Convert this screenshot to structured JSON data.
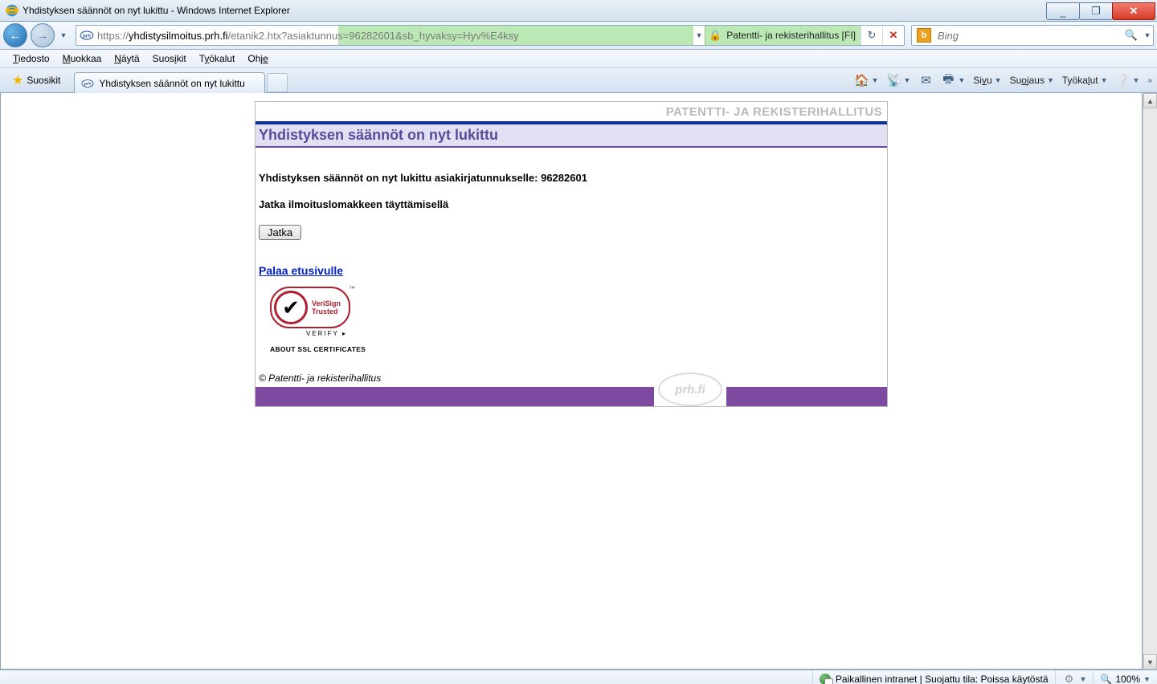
{
  "window": {
    "title": "Yhdistyksen säännöt on nyt lukittu - Windows Internet Explorer",
    "min_tip": "_",
    "max_tip": "❐",
    "close_tip": "✕"
  },
  "nav": {
    "url_scheme": "https://",
    "url_host": "yhdistysilmoitus.prh.fi",
    "url_path": "/etanik2.htx?asiaktunnus=96282601&sb_hyvaksy=Hyv%E4ksy",
    "sec_label": "Patentti- ja rekisterihallitus [FI]",
    "search_placeholder": "Bing"
  },
  "menu": {
    "file": "Tiedosto",
    "edit": "Muokkaa",
    "view": "Näytä",
    "favorites": "Suosikit",
    "tools": "Työkalut",
    "help": "Ohje"
  },
  "favbar": {
    "favorites_btn": "Suosikit",
    "tab_title": "Yhdistyksen säännöt on nyt lukittu"
  },
  "cmdbar": {
    "page": "Sivu",
    "safety": "Suojaus",
    "tools": "Työkalut"
  },
  "page": {
    "org": "PATENTTI- JA REKISTERIHALLITUS",
    "h1": "Yhdistyksen säännöt on nyt lukittu",
    "p1": "Yhdistyksen säännöt on nyt lukittu asiakirjatunnukselle: 96282601",
    "p2": "Jatka ilmoituslomakkeen täyttämisellä",
    "continue_btn": "Jatka",
    "home_link": "Palaa etusivulle",
    "vs_line1": "VeriSign",
    "vs_line2": "Trusted",
    "vs_verify": "VERIFY ▸",
    "vs_about": "ABOUT SSL CERTIFICATES",
    "copyright": "© Patentti- ja rekisterihallitus",
    "prh_logo": "prh.fi"
  },
  "status": {
    "zone": "Paikallinen intranet | Suojattu tila: Poissa käytöstä",
    "zoom": "100%"
  }
}
